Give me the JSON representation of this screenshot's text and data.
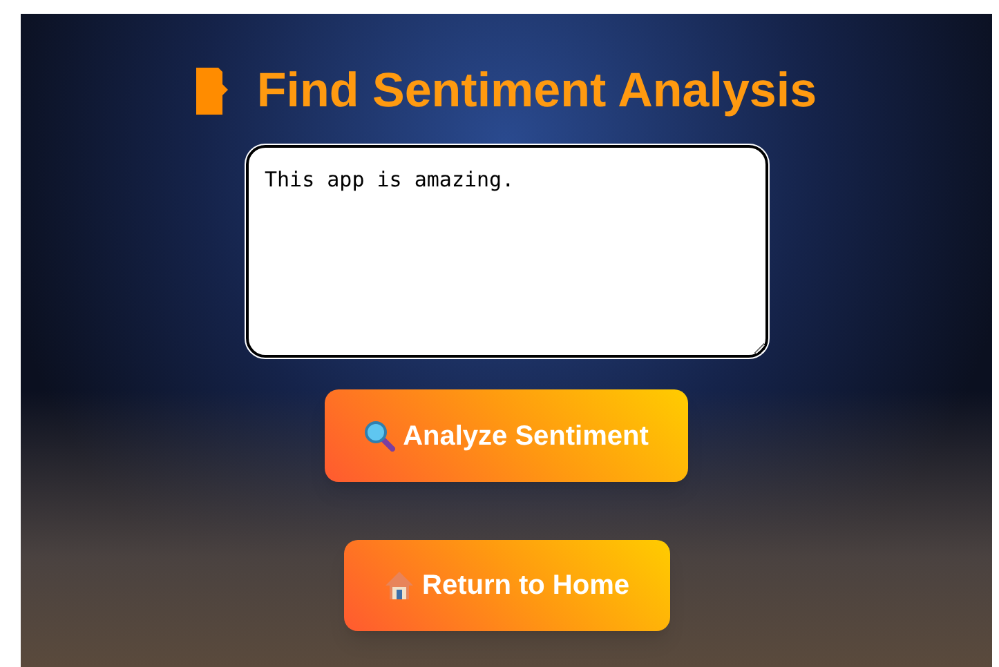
{
  "title": "Find Sentiment Analysis",
  "input": {
    "value": "This app is amazing."
  },
  "buttons": [
    {
      "kind": "analyze",
      "label": "Analyze Sentiment"
    },
    {
      "kind": "home",
      "label": "Return to Home"
    }
  ]
}
